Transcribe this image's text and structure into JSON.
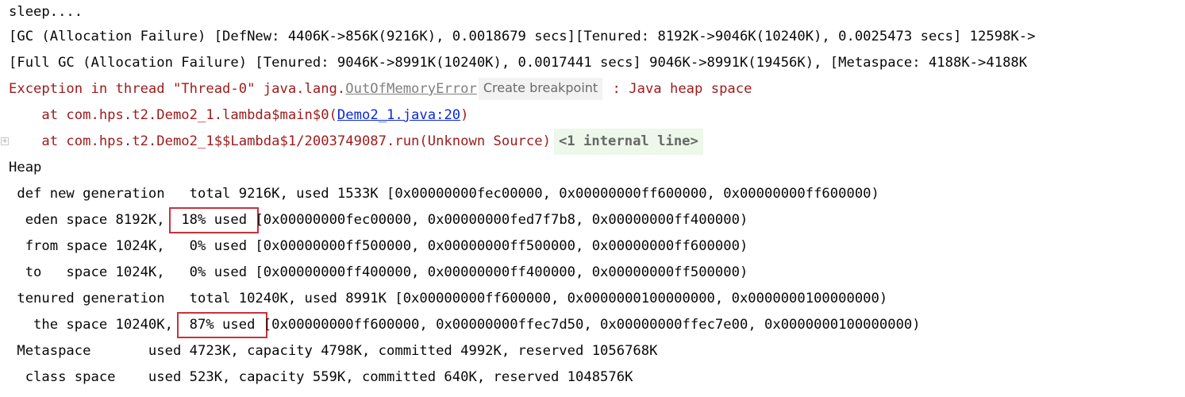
{
  "console": {
    "sleep": "sleep....",
    "gc_line": "[GC (Allocation Failure) [DefNew: 4406K->856K(9216K), 0.0018679 secs][Tenured: 8192K->9046K(10240K), 0.0025473 secs] 12598K->",
    "full_gc_line": "[Full GC (Allocation Failure) [Tenured: 9046K->8991K(10240K), 0.0017441 secs] 9046K->8991K(19456K), [Metaspace: 4188K->4188K",
    "exception": {
      "prefix": "Exception in thread \"Thread-0\" java.lang.",
      "error_link": "OutOfMemoryError",
      "breakpoint_tooltip": "Create breakpoint",
      "suffix": " : Java heap space"
    },
    "stack": [
      {
        "prefix": "    at com.hps.t2.Demo2_1.lambda$main$0(",
        "link": "Demo2_1.java:20",
        "suffix": ")"
      },
      {
        "text": "    at com.hps.t2.Demo2_1$$Lambda$1/2003749087.run(Unknown Source)",
        "internal": "<1 internal line>"
      }
    ],
    "heap": {
      "title": "Heap",
      "def_new": " def new generation   total 9216K, used 1533K [0x00000000fec00000, 0x00000000ff600000, 0x00000000ff600000)",
      "eden": {
        "prefix": "  eden space 8192K, ",
        "used": " 18% used ",
        "suffix": "[0x00000000fec00000, 0x00000000fed7f7b8, 0x00000000ff400000)"
      },
      "from": "  from space 1024K,   0% used [0x00000000ff500000, 0x00000000ff500000, 0x00000000ff600000)",
      "to": "  to   space 1024K,   0% used [0x00000000ff400000, 0x00000000ff400000, 0x00000000ff500000)",
      "tenured": " tenured generation   total 10240K, used 8991K [0x00000000ff600000, 0x0000000100000000, 0x0000000100000000)",
      "the_space": {
        "prefix": "   the space 10240K, ",
        "used": " 87% used ",
        "suffix": "[0x00000000ff600000, 0x00000000ffec7d50, 0x00000000ffec7e00, 0x0000000100000000)"
      },
      "metaspace": " Metaspace       used 4723K, capacity 4798K, committed 4992K, reserved 1056768K",
      "class_space": "  class space    used 523K, capacity 559K, committed 640K, reserved 1048576K"
    }
  },
  "colors": {
    "error_text": "#9e1a1a",
    "link": "#0a2ad6",
    "highlight_box": "#c8323c",
    "internal_bg": "#edf7ea"
  },
  "icons": {
    "fold": "fold-expand-icon"
  }
}
